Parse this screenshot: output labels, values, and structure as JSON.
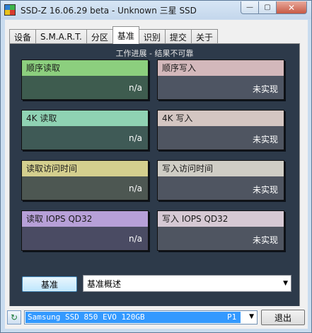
{
  "window": {
    "title": "SSD-Z 16.06.29 beta - Unknown 三星 SSD",
    "minimize_glyph": "—",
    "maximize_glyph": "▢",
    "close_glyph": "✕"
  },
  "tabs": [
    {
      "label": "设备"
    },
    {
      "label": "S.M.A.R.T."
    },
    {
      "label": "分区"
    },
    {
      "label": "基准"
    },
    {
      "label": "识别"
    },
    {
      "label": "提交"
    },
    {
      "label": "关于"
    }
  ],
  "active_tab": "基准",
  "panel": {
    "caption": "工作进展 - 结果不可靠"
  },
  "tiles": {
    "seq_read": {
      "label": "顺序读取",
      "value": "n/a",
      "head_color": "#8ccf7e",
      "body_color": "#3e5c4f"
    },
    "seq_write": {
      "label": "顺序写入",
      "value": "未实现",
      "head_color": "#d3b8bb",
      "body_color": "#4e5563"
    },
    "k4_read": {
      "label": "4K 读取",
      "value": "n/a",
      "head_color": "#8fd2b3",
      "body_color": "#3f5a56"
    },
    "k4_write": {
      "label": "4K 写入",
      "value": "未实现",
      "head_color": "#d4c6c2",
      "body_color": "#4f5561"
    },
    "access_read": {
      "label": "读取访问时间",
      "value": "n/a",
      "head_color": "#d4cf8e",
      "body_color": "#4d5752"
    },
    "access_write": {
      "label": "写入访问时间",
      "value": "未实现",
      "head_color": "#cfcdc5",
      "body_color": "#4f5561"
    },
    "iops_read": {
      "label": "读取 IOPS QD32",
      "value": "n/a",
      "head_color": "#b7a0d8",
      "body_color": "#4a4b63"
    },
    "iops_write": {
      "label": "写入 IOPS QD32",
      "value": "未实现",
      "head_color": "#d6c9d4",
      "body_color": "#4f5561"
    }
  },
  "controls": {
    "benchmark_button": "基准",
    "summary_select": "基准概述"
  },
  "status_bar": {
    "drive_name": "Samsung SSD 850 EVO 120GB",
    "drive_port": "P1",
    "exit_button": "退出"
  },
  "icons": {
    "app": "ssd-z-app-icon",
    "refresh": "refresh-icon",
    "dropdown": "chevron-down-icon"
  }
}
